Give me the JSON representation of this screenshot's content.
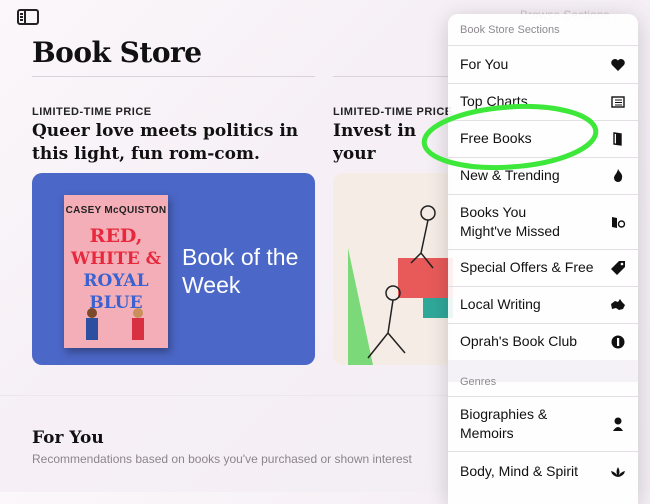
{
  "page": {
    "title": "Book Store",
    "faded_top": "Browse Sections"
  },
  "features": [
    {
      "eyebrow": "LIMITED-TIME PRICE",
      "headline": "Queer love meets politics in this light, fun rom-com.",
      "card_label": "Book of the Week",
      "book": {
        "author": "CASEY McQUISTON",
        "title_lines": [
          "RED,",
          "WHITE &",
          "ROYAL",
          "BLUE"
        ]
      }
    },
    {
      "eyebrow": "LIMITED-TIME PRICE",
      "headline": "Invest in your helpful guide"
    }
  ],
  "for_you": {
    "title": "For You",
    "subtitle": "Recommendations based on books you've purchased or shown interest"
  },
  "popover": {
    "header": "Book Store Sections",
    "items": [
      {
        "label": "For You",
        "icon": "heart-icon"
      },
      {
        "label": "Top Charts",
        "icon": "list-icon"
      },
      {
        "label": "Free Books",
        "icon": "book-icon"
      },
      {
        "label": "New & Trending",
        "icon": "flame-icon"
      },
      {
        "label": "Books You Might've Missed",
        "icon": "book-map-icon"
      },
      {
        "label": "Special Offers & Free",
        "icon": "tag-icon"
      },
      {
        "label": "Local Writing",
        "icon": "australia-icon"
      },
      {
        "label": "Oprah's Book Club",
        "icon": "oprah-icon"
      }
    ],
    "genres_header": "Genres",
    "genres": [
      {
        "label": "Biographies & Memoirs",
        "icon": "person-bust-icon"
      },
      {
        "label": "Body, Mind & Spirit",
        "icon": "lotus-icon"
      }
    ]
  },
  "colors": {
    "card_blue": "#4b67c7",
    "highlight_green": "#3ee83a"
  }
}
